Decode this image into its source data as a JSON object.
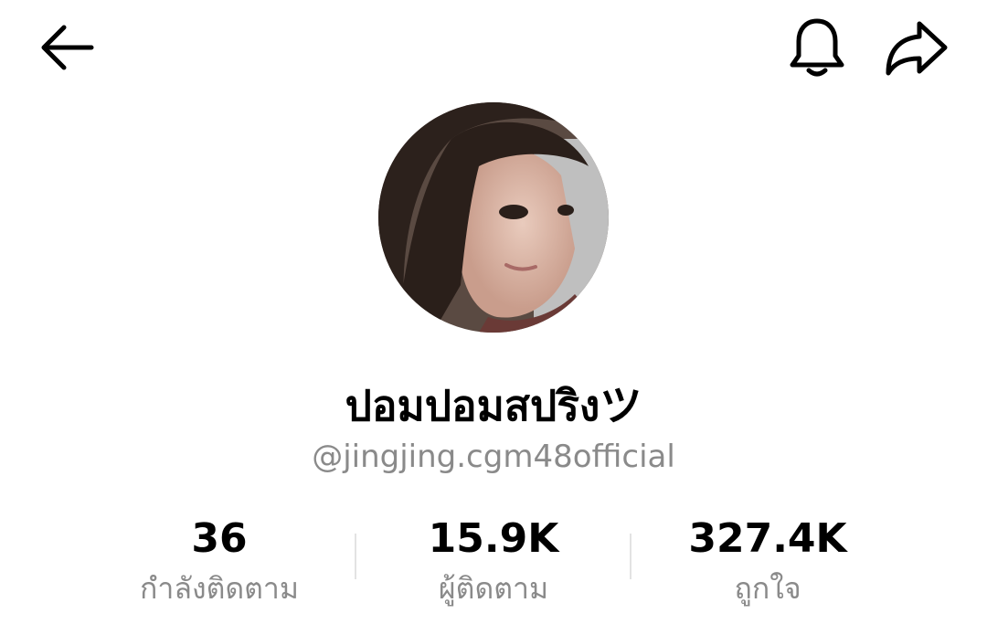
{
  "header": {
    "back_icon": "arrow-left-icon",
    "notification_icon": "bell-icon",
    "share_icon": "share-arrow-icon"
  },
  "profile": {
    "avatar_icon": "profile-photo",
    "display_name": "ปอมปอมสปริงツ",
    "username": "@jingjing.cgm48official"
  },
  "stats": [
    {
      "value": "36",
      "label": "กำลังติดตาม"
    },
    {
      "value": "15.9K",
      "label": "ผู้ติดตาม"
    },
    {
      "value": "327.4K",
      "label": "ถูกใจ"
    }
  ],
  "colors": {
    "text_primary": "#000000",
    "text_secondary": "#8a8a8a",
    "divider": "#e3e3e3",
    "background": "#ffffff"
  }
}
